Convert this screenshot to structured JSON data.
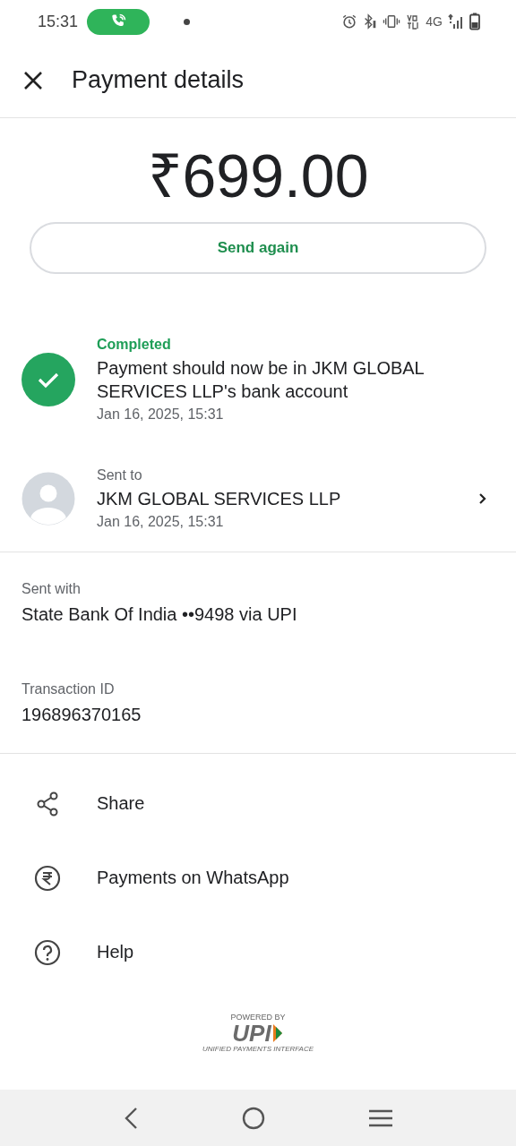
{
  "status_bar": {
    "time": "15:31",
    "call_active": true,
    "network": "4G"
  },
  "header": {
    "title": "Payment details"
  },
  "amount": "₹699.00",
  "send_again_button": "Send again",
  "status": {
    "label": "Completed",
    "message": "Payment should now be in JKM GLOBAL SERVICES LLP's bank account",
    "time": "Jan 16, 2025, 15:31",
    "completed": true
  },
  "recipient": {
    "label": "Sent to",
    "name": "JKM GLOBAL SERVICES LLP",
    "time": "Jan 16, 2025, 15:31"
  },
  "details": [
    {
      "label": "Sent with",
      "value": "State Bank Of India ••9498 via UPI"
    },
    {
      "label": "Transaction ID",
      "value": "196896370165"
    }
  ],
  "actions": [
    {
      "kind": "share",
      "label": "Share"
    },
    {
      "kind": "rupee",
      "label": "Payments on WhatsApp"
    },
    {
      "kind": "help",
      "label": "Help"
    }
  ],
  "footer_logo": {
    "top": "POWERED BY",
    "mark": "UPI",
    "bottom": "UNIFIED PAYMENTS INTERFACE"
  }
}
